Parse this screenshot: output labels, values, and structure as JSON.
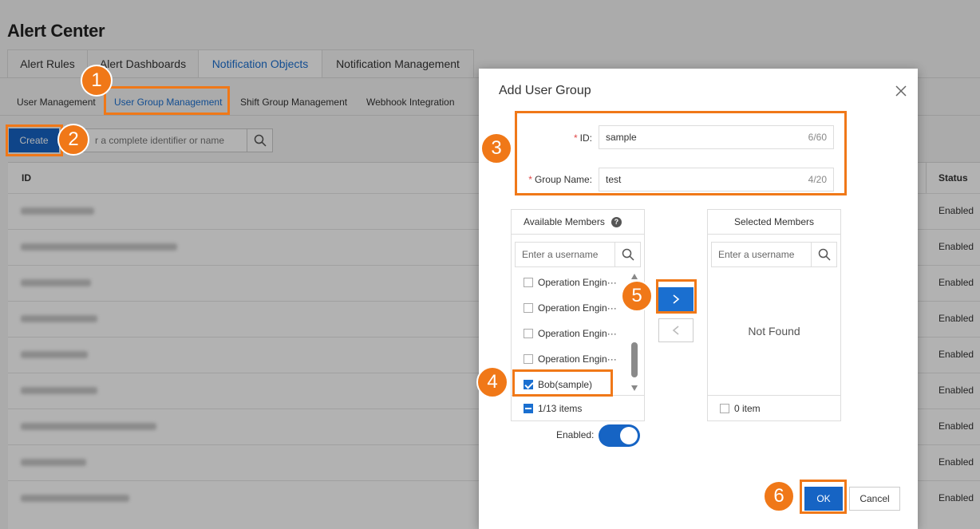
{
  "page": {
    "title": "Alert Center",
    "tabs": [
      {
        "label": "Alert Rules",
        "active": false
      },
      {
        "label": "Alert Dashboards",
        "active": false
      },
      {
        "label": "Notification Objects",
        "active": true
      },
      {
        "label": "Notification Management",
        "active": false
      }
    ],
    "subtabs": [
      {
        "label": "User Management",
        "active": false
      },
      {
        "label": "User Group Management",
        "active": true
      },
      {
        "label": "Shift Group Management",
        "active": false
      },
      {
        "label": "Webhook Integration",
        "active": false
      }
    ],
    "create_label": "Create",
    "search_placeholder": "r a complete identifier or name",
    "table": {
      "col_id": "ID",
      "col_status": "Status",
      "rows": [
        {
          "status": "Enabled"
        },
        {
          "status": "Enabled"
        },
        {
          "status": "Enabled"
        },
        {
          "status": "Enabled"
        },
        {
          "status": "Enabled"
        },
        {
          "status": "Enabled"
        },
        {
          "status": "Enabled"
        },
        {
          "status": "Enabled"
        },
        {
          "status": "Enabled"
        }
      ]
    }
  },
  "dialog": {
    "title": "Add User Group",
    "required_mark": "*",
    "id_label": "ID:",
    "id_value": "sample",
    "id_count": "6/60",
    "name_label": "Group Name:",
    "name_value": "test",
    "name_count": "4/20",
    "available": {
      "title": "Available Members",
      "help": "?",
      "search_placeholder": "Enter a username",
      "items": [
        {
          "label": "Operation Engin···",
          "checked": false
        },
        {
          "label": "Operation Engin···",
          "checked": false
        },
        {
          "label": "Operation Engin···",
          "checked": false
        },
        {
          "label": "Operation Engin···",
          "checked": false
        },
        {
          "label": "Bob(sample)",
          "checked": true
        }
      ],
      "footer": "1/13 items"
    },
    "selected": {
      "title": "Selected Members",
      "search_placeholder": "Enter a username",
      "empty_text": "Not Found",
      "footer": "0 item"
    },
    "move_right": ">",
    "move_left": "<",
    "enabled_label": "Enabled:",
    "enabled": true,
    "ok_label": "OK",
    "cancel_label": "Cancel"
  },
  "markers": [
    "1",
    "2",
    "3",
    "4",
    "5",
    "6"
  ],
  "colors": {
    "primary": "#1664c4",
    "link": "#1a6fd0",
    "highlight": "#f07818",
    "required": "#e04848"
  }
}
